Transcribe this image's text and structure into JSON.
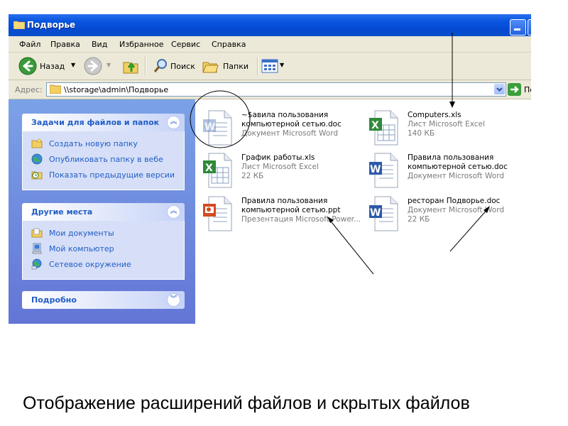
{
  "window": {
    "title": "Подворье"
  },
  "menu": {
    "items": [
      "Файл",
      "Правка",
      "Вид",
      "Избранное",
      "Сервис",
      "Справка"
    ]
  },
  "toolbar": {
    "back_label": "Назад",
    "search_label": "Поиск",
    "folders_label": "Папки"
  },
  "address": {
    "label": "Адрес:",
    "value": "\\\\storage\\admin\\Подворье",
    "go_label": "Пе"
  },
  "panels": {
    "tasks": {
      "title": "Задачи для файлов и папок",
      "items": [
        "Создать новую папку",
        "Опубликовать папку в вебе",
        "Показать предыдущие версии"
      ]
    },
    "places": {
      "title": "Другие места",
      "items": [
        "Мои документы",
        "Мой компьютер",
        "Сетевое окружение"
      ]
    },
    "details": {
      "title": "Подробно"
    }
  },
  "files": [
    {
      "name": "~$авила пользования",
      "name2": "компьютерной сетью.doc",
      "type": "Документ Microsoft Word",
      "size": "",
      "icon": "word-icon"
    },
    {
      "name": "Computers.xls",
      "name2": "",
      "type": "Лист Microsoft Excel",
      "size": "140 КБ",
      "icon": "excel-icon"
    },
    {
      "name": "График работы.xls",
      "name2": "",
      "type": "Лист Microsoft Excel",
      "size": "22 КБ",
      "icon": "excel-icon"
    },
    {
      "name": "Правила пользования",
      "name2": "компьютерной сетью.doc",
      "type": "Документ Microsoft Word",
      "size": "",
      "icon": "word-icon"
    },
    {
      "name": "Правила пользования",
      "name2": "компьютерной сетью.ppt",
      "type": "Презентация Microsoft Power...",
      "size": "",
      "icon": "powerpoint-icon"
    },
    {
      "name": "ресторан Подворье.doc",
      "name2": "",
      "type": "Документ Microsoft Word",
      "size": "22 КБ",
      "icon": "word-icon"
    }
  ],
  "caption": "Отображение расширений файлов и скрытых файлов",
  "colors": {
    "titlebar": "#0549d1",
    "leftpane": "#6f8ad9",
    "link": "#215dc6"
  }
}
